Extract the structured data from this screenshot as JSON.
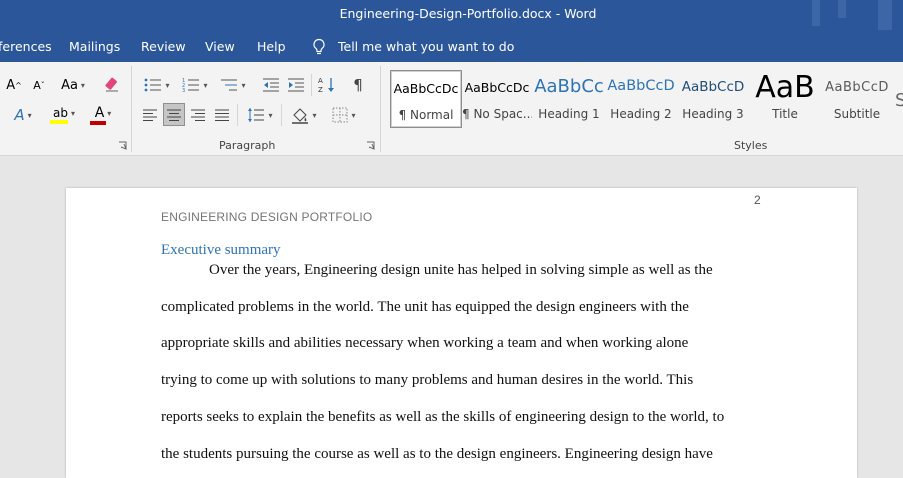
{
  "window": {
    "title": "Engineering-Design-Portfolio.docx  -  Word"
  },
  "tabs": [
    {
      "label": "ferences"
    },
    {
      "label": "Mailings"
    },
    {
      "label": "Review"
    },
    {
      "label": "View"
    },
    {
      "label": "Help"
    }
  ],
  "tell_me": {
    "placeholder": "Tell me what you want to do"
  },
  "ribbon": {
    "font_size_up": "A",
    "font_size_down": "A",
    "change_case": "Aa",
    "text_effects": "A",
    "highlight": "ab",
    "font_color": "A",
    "pilcrow": "¶",
    "paragraph_group_label": "Paragraph",
    "styles_group_label": "Styles",
    "colors": {
      "highlight": "#ffff00",
      "font_color": "#c00000",
      "clear_format": "#e0457b",
      "text_effects": "#2e74b5"
    }
  },
  "styles": [
    {
      "preview": "AaBbCcDc",
      "name": "¶ Normal"
    },
    {
      "preview": "AaBbCcDc",
      "name": "¶ No Spac..."
    },
    {
      "preview": "AaBbCc",
      "name": "Heading 1"
    },
    {
      "preview": "AaBbCcD",
      "name": "Heading 2"
    },
    {
      "preview": "AaBbCcD",
      "name": "Heading 3"
    },
    {
      "preview": "AaB",
      "name": "Title"
    },
    {
      "preview": "AaBbCcD",
      "name": "Subtitle"
    }
  ],
  "document": {
    "page_number": "2",
    "header": "ENGINEERING DESIGN PORTFOLIO",
    "heading": "Executive summary",
    "lines": [
      "Over the years, Engineering design unite has helped in solving simple as well as the",
      "complicated problems in the world. The unit has equipped the design engineers with the",
      "appropriate skills and abilities necessary when working a team and when working alone",
      "trying to come up with solutions to many problems and human desires in the world. This",
      "reports seeks to explain the benefits as well as the skills of engineering design to the world, to",
      "the students pursuing the course as well as to the design engineers. Engineering design have"
    ]
  }
}
